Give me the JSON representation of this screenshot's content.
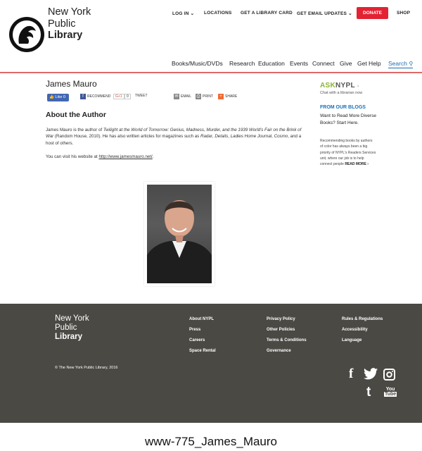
{
  "logo": {
    "line1": "New York",
    "line2": "Public",
    "line3": "Library"
  },
  "utility_nav": {
    "login": "LOG IN",
    "locations": "LOCATIONS",
    "library_card": "GET A LIBRARY CARD",
    "email_updates": "GET EMAIL UPDATES",
    "donate": "DONATE",
    "shop": "SHOP"
  },
  "main_nav": [
    "Books/Music/DVDs",
    "Research",
    "Education",
    "Events",
    "Connect",
    "Give",
    "Get Help",
    "Search"
  ],
  "page": {
    "title": "James Mauro",
    "share": {
      "like": "Like 0",
      "recommend": "RECOMMEND",
      "gplus": "G+1",
      "gplus_count": "0",
      "tweet": "TWEET",
      "email": "EMAIL",
      "print": "PRINT",
      "share": "SHARE"
    },
    "about_heading": "About the Author",
    "bio": {
      "p1_start": "James Mauro is the author of ",
      "book_title": "Twilight at the World of Tomorrow: Genius, Madness, Murder, and the 1939 World's Fair on the Brink of War",
      "p1_mid": " (Random House, 2010). He has also written articles for magazines such as ",
      "mag1": "Radar",
      "sep1": ", ",
      "mag2": "Details",
      "sep2": ", ",
      "mag3": "Ladies Home Journal",
      "sep3": ", ",
      "mag4": "Cosmo",
      "p1_end": ", and a host of others.",
      "website_prefix": "You can visit his website at ",
      "website_url": "http://www.jamesmauro.net/",
      "website_suffix": "."
    }
  },
  "sidebar": {
    "ask": "ASK",
    "nypl": "NYPL",
    "chat": "Chat with a librarian now",
    "blogs_heading": "FROM OUR BLOGS",
    "blog_title": "Want to Read More Diverse Books? Start Here.",
    "blog_desc": "Recommending books by authors of color has always been a big priority of NYPL's Readers Services unit, where our job is to help connect people",
    "read_more": "READ MORE ›"
  },
  "footer": {
    "logo": {
      "line1": "New York",
      "line2": "Public",
      "line3": "Library"
    },
    "col1": [
      "About NYPL",
      "Press",
      "Careers",
      "Space Rental"
    ],
    "col2": [
      "Privacy Policy",
      "Other Policies",
      "Terms & Conditions",
      "Governance"
    ],
    "col3": [
      "Rules & Regulations",
      "Accessibility",
      "Language"
    ],
    "copyright": "© The New York Public Library, 2016",
    "social_icons": [
      "facebook-icon",
      "twitter-icon",
      "instagram-icon",
      "tumblr-icon",
      "youtube-icon"
    ]
  },
  "caption": "www-775_James_Mauro",
  "colors": {
    "donate": "#e32232",
    "accent_blue": "#1b6fb6",
    "footer_bg": "#4b4944",
    "ask_green": "#8ab532"
  }
}
